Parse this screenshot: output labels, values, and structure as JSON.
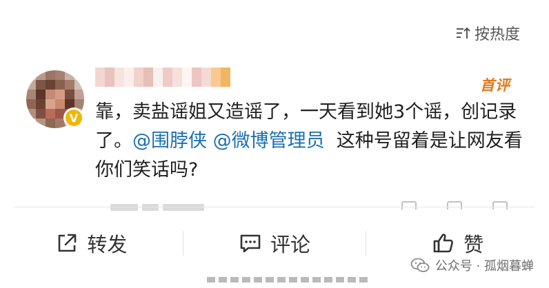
{
  "sort": {
    "label": "按热度",
    "icon": "sort-icon"
  },
  "comment": {
    "first_badge": "首评",
    "text_part1": "靠，卖盐谣姐又造谣了，一天看到她3个谣，创记录了。",
    "mention1": "@围脖侠",
    "mention2": "@微博管理员",
    "text_part2": "  这种号留着是让网友看你们笑话吗?",
    "verified_badge": "V"
  },
  "actions": {
    "repost": {
      "label": "转发",
      "icon": "share-icon"
    },
    "comment": {
      "label": "评论",
      "icon": "comment-icon"
    },
    "like": {
      "label": "赞",
      "icon": "thumbs-up-icon"
    }
  },
  "watermark": {
    "text": "公众号 · 孤烟暮蝉",
    "icon": "wechat-icon"
  },
  "colors": {
    "mention": "#1a6fb3",
    "first_badge": "#e07a18",
    "verified": "#f2b705"
  }
}
